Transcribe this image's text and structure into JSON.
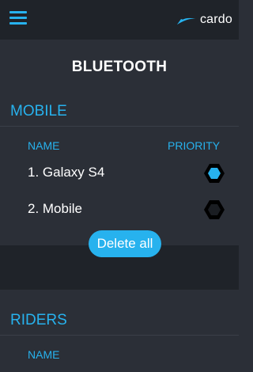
{
  "topbar": {
    "menu_icon": "hamburger-menu-icon",
    "brand_logo_icon": "cardo-swoosh-icon",
    "brand_text": "cardo"
  },
  "title": "BLUETOOTH",
  "mobile_section": {
    "header": "MOBILE",
    "col_name": "NAME",
    "col_priority": "PRIORITY",
    "devices": [
      {
        "label": "1. Galaxy S4",
        "priority_selected": true
      },
      {
        "label": "2. Mobile",
        "priority_selected": false
      }
    ],
    "delete_all_label": "Delete all"
  },
  "riders_section": {
    "header": "RIDERS",
    "col_name": "NAME"
  },
  "colors": {
    "accent": "#27b2ee",
    "background": "#2b2f37",
    "bar": "#1f2329",
    "text": "#ffffff"
  }
}
